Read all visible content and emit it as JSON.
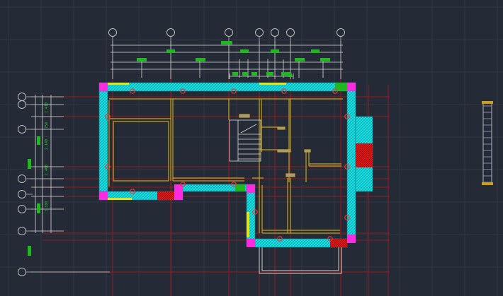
{
  "drawing": {
    "background": "#252b36",
    "colors": {
      "grid": "#2f3643",
      "axis": "#b01818",
      "dimension": "#d8d8d8",
      "dim_text": "#2ec82e",
      "bubble": "#bdbdbd",
      "wall_fill": "#19e3e3",
      "wall_edge": "#0d7d8a",
      "column": "#ff2be0",
      "column_red": "#ff1a1a",
      "inner_wall": "#c8a01e",
      "window": "#e8e8e8",
      "stair": "#d9d9d9",
      "green_block": "#1fb81f",
      "yellow_line": "#e3e31a",
      "axis_dot": "#ff3030"
    },
    "icons": {
      "axis_bubble": "circle-icon",
      "axis_marker": "dot-icon",
      "column": "square-icon"
    },
    "vertical_dims": [
      "1.410",
      "750",
      "2.140",
      "1.400",
      "3.330"
    ]
  }
}
